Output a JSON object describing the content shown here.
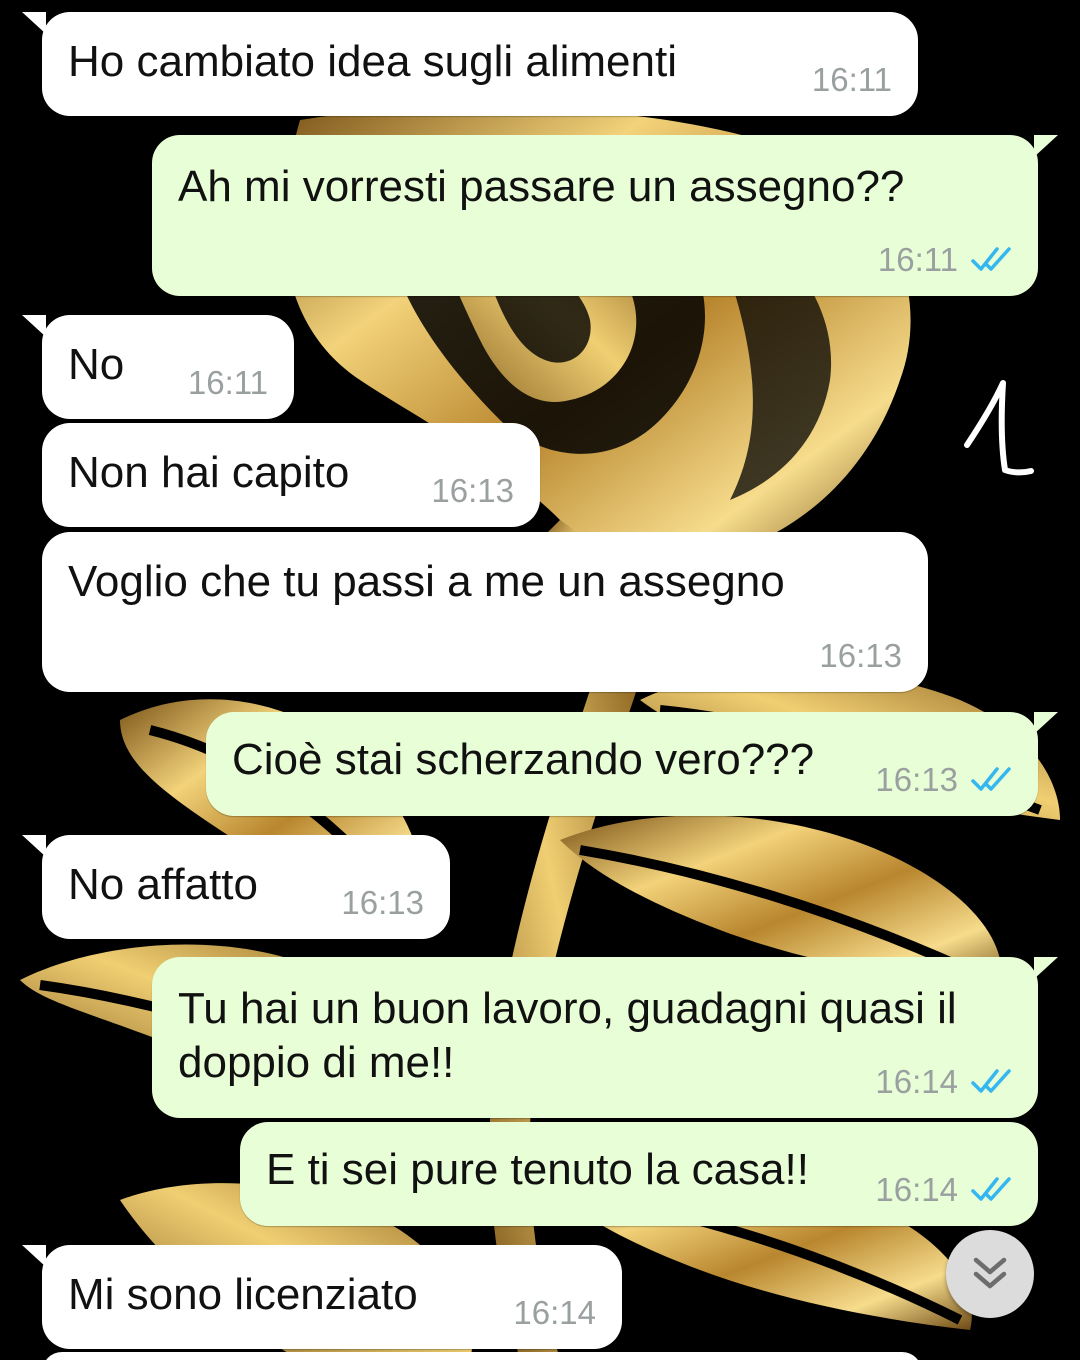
{
  "messages": [
    {
      "dir": "in",
      "text": "Ho cambiato idea sugli alimenti",
      "time": "16:11"
    },
    {
      "dir": "out",
      "text": "Ah mi vorresti passare un assegno??",
      "time": "16:11",
      "read": true
    },
    {
      "dir": "in",
      "text": "No",
      "time": "16:11"
    },
    {
      "dir": "in",
      "text": "Non hai capito",
      "time": "16:13"
    },
    {
      "dir": "in",
      "text": "Voglio che tu passi a me un assegno",
      "time": "16:13"
    },
    {
      "dir": "out",
      "text": "Cioè stai scherzando vero???",
      "time": "16:13",
      "read": true
    },
    {
      "dir": "in",
      "text": "No affatto",
      "time": "16:13"
    },
    {
      "dir": "out",
      "text_line1": "Tu hai un buon lavoro, guadagni quasi il",
      "text_line2": "doppio di me!!",
      "time": "16:14",
      "read": true
    },
    {
      "dir": "out",
      "text": "E ti sei pure tenuto la casa!!",
      "time": "16:14",
      "read": true
    },
    {
      "dir": "in",
      "text": "Mi sono licenziato",
      "time": "16:14"
    }
  ],
  "annotation": {
    "text": "1"
  },
  "scroll_button": {
    "icon": "double-chevron-down-icon"
  },
  "colors": {
    "incoming_bubble": "#ffffff",
    "outgoing_bubble": "#e7fed6",
    "timestamp": "#9aa0a0",
    "read_ticks": "#34b7f1",
    "wallpaper_bg": "#000000",
    "wallpaper_gold": "#c9a23a"
  }
}
